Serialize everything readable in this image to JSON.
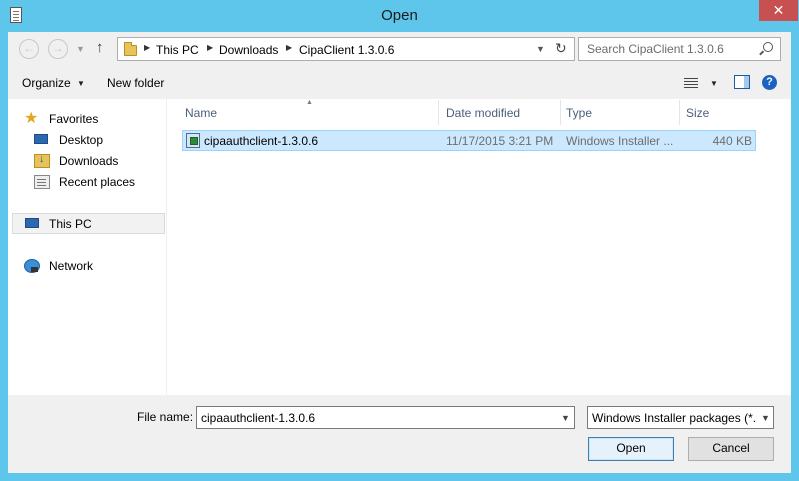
{
  "window": {
    "title": "Open",
    "close_symbol": "✕"
  },
  "address_bar": {
    "crumbs": [
      "This PC",
      "Downloads",
      "CipaClient 1.3.0.6"
    ],
    "refresh_symbol": "↻"
  },
  "search": {
    "placeholder": "Search CipaClient 1.3.0.6"
  },
  "toolbar": {
    "organize_label": "Organize",
    "new_folder_label": "New folder",
    "help_symbol": "?"
  },
  "nav_pane": {
    "favorites": "Favorites",
    "desktop": "Desktop",
    "downloads": "Downloads",
    "recent_places": "Recent places",
    "this_pc": "This PC",
    "network": "Network"
  },
  "file_list": {
    "columns": [
      "Name",
      "Date modified",
      "Type",
      "Size"
    ],
    "sort_column": "Name",
    "rows": [
      {
        "name": "cipaauthclient-1.3.0.6",
        "date_modified": "11/17/2015 3:21 PM",
        "type": "Windows Installer ...",
        "size": "440 KB",
        "selected": true
      }
    ]
  },
  "footer": {
    "file_name_label": "File name:",
    "file_name_value": "cipaauthclient-1.3.0.6",
    "file_type_value": "Windows Installer packages (*.msi)",
    "open_label": "Open",
    "cancel_label": "Cancel"
  },
  "icons": {
    "app": "document-icon",
    "back": "back-arrow-icon",
    "forward": "forward-arrow-icon",
    "up": "up-arrow-icon",
    "folder": "folder-icon",
    "search": "search-icon",
    "views": "details-view-icon",
    "preview": "preview-pane-icon",
    "help": "help-icon",
    "favorites": "star-icon",
    "desktop": "desktop-icon",
    "downloads": "downloads-folder-icon",
    "recent": "recent-places-icon",
    "this_pc": "computer-icon",
    "network": "network-icon",
    "msi": "installer-package-icon"
  },
  "colors": {
    "frame": "#5ec6ea",
    "close_button": "#c75050",
    "selection_fill": "#cce8ff",
    "selection_border": "#99d1ff",
    "header_text": "#4c607a"
  }
}
